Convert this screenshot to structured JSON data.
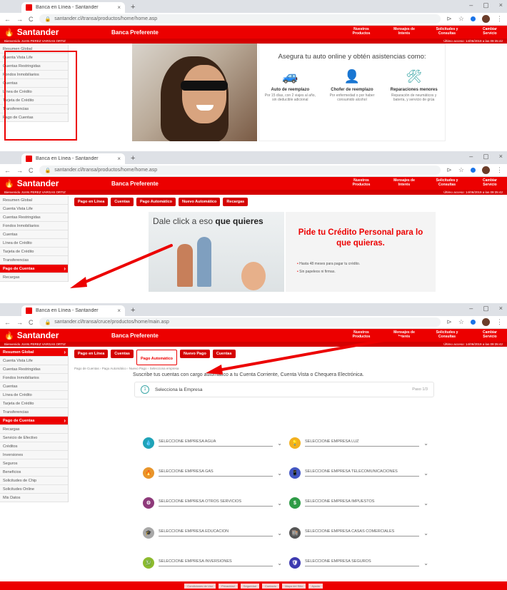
{
  "browser": {
    "tab_title": "Banca en Línea - Santander",
    "tab_close": "×",
    "new_tab": "+",
    "window_controls": [
      "–",
      "▢",
      "×"
    ],
    "url_p1": "santander.cl/transa/productos/home/home.asp",
    "url_p2": "santander.cl/transa/productos/home/home.asp",
    "url_p3": "santander.cl/transa/cruce/productos/home/main.asp"
  },
  "brand": {
    "logo": "Santander",
    "logo_icon": "flame-icon",
    "section": "Banca Preferente",
    "color": "#ec0000"
  },
  "topmenu": [
    "Nuestros Productos",
    "Mensajes de Interés",
    "Solicitudes y Consultas",
    "Cambiar Servicio"
  ],
  "user_line": "Bienvenido JUAN PEREZ VARGAS ORTIZ",
  "last_access": "Último acceso: 14/06/2019 a las 09:35:42",
  "sidebar_p1": [
    "Resumen Global",
    "Cuenta Vista Life",
    "Cuentas Restringidas",
    "Fondos Inmobiliarios",
    "Cuentas",
    "Línea de Crédito",
    "Tarjeta de Crédito",
    "Transferencias",
    "Pago de Cuentas"
  ],
  "sidebar_p2": [
    "Resumen Global",
    "Cuenta Vista Life",
    "Cuentas Restringidas",
    "Fondos Inmobiliarios",
    "Cuentas",
    "Línea de Crédito",
    "Tarjeta de Crédito",
    "Transferencias",
    "Pago de Cuentas",
    "Recargas"
  ],
  "sidebar_p3": [
    "Resumen Global",
    "Cuenta Vista Life",
    "Cuentas Restringidas",
    "Fondos Inmobiliarios",
    "Cuentas",
    "Línea de Crédito",
    "Tarjeta de Crédito",
    "Transferencias",
    "Pago de Cuentas",
    "Recargas",
    "Servicio de Efectivo",
    "Créditos",
    "Inversiones",
    "Seguros",
    "Beneficios",
    "Solicitudes de Chip",
    "Solicitudes Online",
    "Mis Datos"
  ],
  "panel1": {
    "heading": "Asegura tu auto online y obtén asistencias como:",
    "features": [
      {
        "icon": "car-icon",
        "title": "Auto de reemplazo",
        "desc": "Por 15 días, con 2 viajes al año, sin deducible adicional"
      },
      {
        "icon": "person-icon",
        "title": "Chofer de reemplazo",
        "desc": "Por enfermedad o por haber consumido alcohol"
      },
      {
        "icon": "tools-icon",
        "title": "Reparaciones menores",
        "desc": "Reparación de neumáticos y batería, y servicio de grúa"
      }
    ]
  },
  "panel2": {
    "subtabs": [
      "Pago en Línea",
      "Cuentas",
      "Pago Automático",
      "Nuevo Automático",
      "Recargas"
    ],
    "banner_text_a": "Dale click a eso ",
    "banner_text_b": "que quieres",
    "promo_title": "Pide tu Crédito Personal para lo que quieras.",
    "promo_points": [
      "Hasta 48 meses para pagar tu crédito.",
      "Sin papeleos ni firmas."
    ]
  },
  "panel3": {
    "subtabs": [
      "Pago en Línea",
      "Cuentas",
      "Pago Automático",
      "Nuevo Pago",
      "Cuentas"
    ],
    "breadcrumb": "Pago de Cuentas › Pago Automático › Nuevo Pago › Selecciona empresa",
    "instruction": "Suscribe tus cuentas con cargo automático a tu Cuenta Corriente, Cuenta Vista o Chequera Electrónica.",
    "step_num": "1",
    "step_label": "Selecciona la Empresa",
    "step_count": "Paso 1/3",
    "selects": [
      {
        "label": "SELECCIONE EMPRESA AGUA",
        "icon": "water-drop-icon",
        "glyph": "💧",
        "color": "#1fa3b8"
      },
      {
        "label": "SELECCIONE EMPRESA LUZ",
        "icon": "bulb-icon",
        "glyph": "💡",
        "color": "#f2b01e"
      },
      {
        "label": "SELECCIONE EMPRESA GAS",
        "icon": "flame-icon",
        "glyph": "🔥",
        "color": "#e8952b"
      },
      {
        "label": "SELECCIONE EMPRESA TELECOMUNICACIONES",
        "icon": "phone-icon",
        "glyph": "📱",
        "color": "#4357c3"
      },
      {
        "label": "SELECCIONE EMPRESA OTROS SERVICIOS",
        "icon": "services-icon",
        "glyph": "⚙",
        "color": "#8e3a7a"
      },
      {
        "label": "SELECCIONE EMPRESA IMPUESTOS",
        "icon": "tax-icon",
        "glyph": "$",
        "color": "#2e9b46"
      },
      {
        "label": "SELECCIONE EMPRESA EDUCACIÓN",
        "icon": "education-icon",
        "glyph": "🎓",
        "color": "#a8a8a8"
      },
      {
        "label": "SELECCIONE EMPRESA CASAS COMERCIALES",
        "icon": "store-icon",
        "glyph": "🏬",
        "color": "#555555"
      },
      {
        "label": "SELECCIONE EMPRESA INVERSIONES",
        "icon": "investment-icon",
        "glyph": "💹",
        "color": "#8dbb2e"
      },
      {
        "label": "SELECCIONE EMPRESA SEGUROS",
        "icon": "shield-icon",
        "glyph": "🛡",
        "color": "#3d3ab0"
      }
    ],
    "footer_links": [
      "Condiciones de Uso",
      "Privacidad",
      "Seguridad",
      "Contacto",
      "Mapa del Sitio",
      "Ayuda"
    ]
  }
}
